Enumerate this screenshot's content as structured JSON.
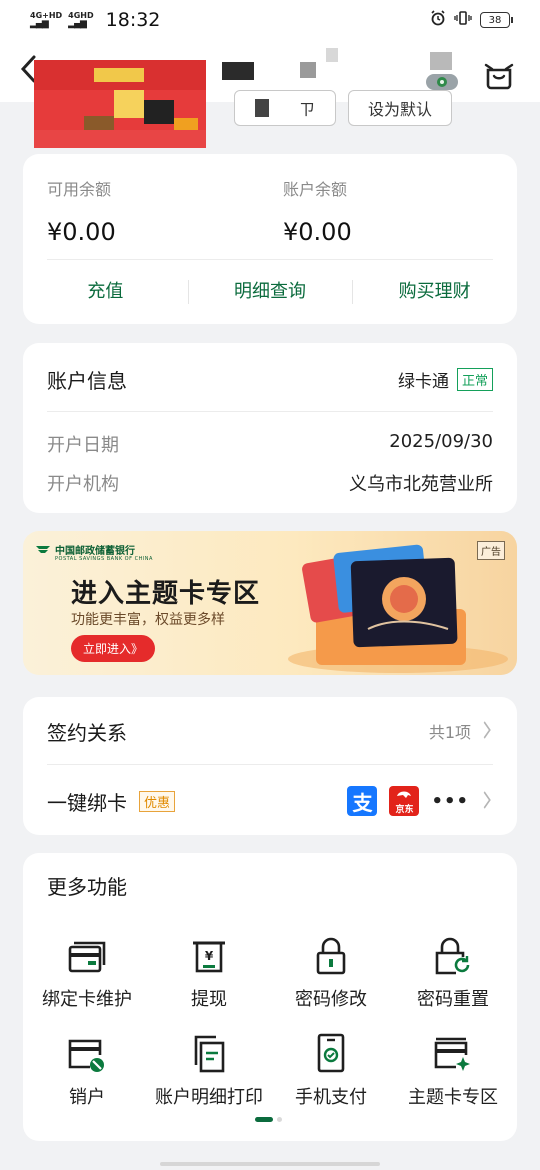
{
  "status_bar": {
    "net1": "4G+HD",
    "net2": "4GHD",
    "time": "18:32",
    "battery": "38"
  },
  "header": {
    "back_icon": "chevron-left-icon",
    "service_icon": "customer-service-icon",
    "button_left": "ㄗ",
    "button_default": "设为默认"
  },
  "balance": {
    "available_label": "可用余额",
    "available_value": "¥0.00",
    "account_label": "账户余额",
    "account_value": "¥0.00",
    "actions": [
      "充值",
      "明细查询",
      "购买理财"
    ],
    "accent_color": "#0b6b3d"
  },
  "account_info": {
    "title": "账户信息",
    "type": "绿卡通",
    "status": "正常",
    "open_date_label": "开户日期",
    "open_date": "2025/09/30",
    "branch_label": "开户机构",
    "branch": "义乌市北苑营业所"
  },
  "banner": {
    "bank_name": "中国邮政储蓄银行",
    "bank_name_en": "POSTAL SAVINGS BANK OF CHINA",
    "title": "进入主题卡专区",
    "subtitle": "功能更丰富，权益更多样",
    "cta": "立即进入》",
    "ad_tag": "广告"
  },
  "sign": {
    "title": "签约关系",
    "count": "共1项",
    "bind_title": "一键绑卡",
    "bind_badge": "优惠",
    "alipay_glyph": "支",
    "jd_label": "京东",
    "more_dots": "•••"
  },
  "more": {
    "title": "更多功能",
    "items": [
      {
        "label": "绑定卡维护",
        "icon": "card-maintain-icon"
      },
      {
        "label": "提现",
        "icon": "withdraw-icon"
      },
      {
        "label": "密码修改",
        "icon": "lock-icon"
      },
      {
        "label": "密码重置",
        "icon": "lock-reset-icon"
      },
      {
        "label": "销户",
        "icon": "close-account-icon"
      },
      {
        "label": "账户明细打印",
        "icon": "print-statement-icon"
      },
      {
        "label": "手机支付",
        "icon": "mobile-pay-icon"
      },
      {
        "label": "主题卡专区",
        "icon": "theme-card-icon"
      }
    ]
  }
}
